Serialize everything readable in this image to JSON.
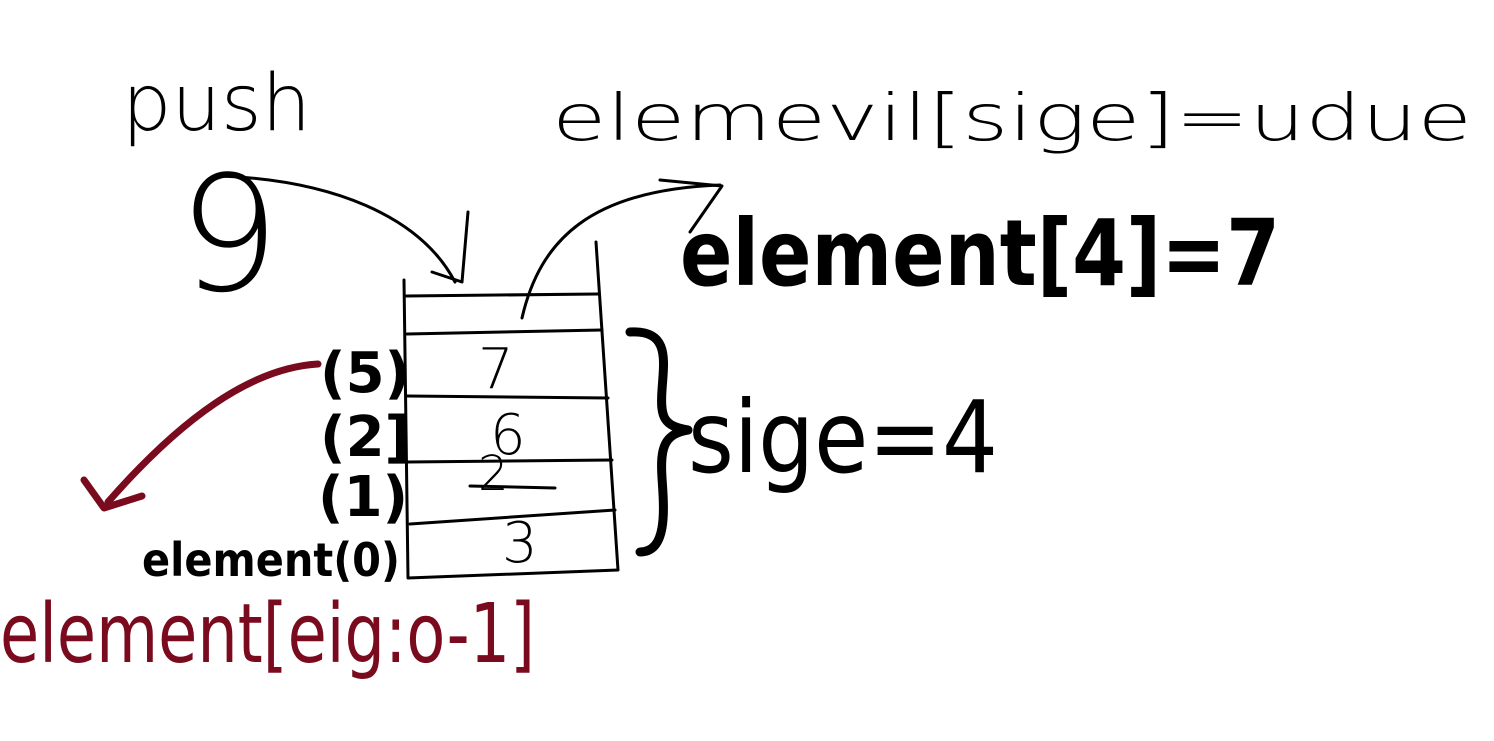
{
  "labels": {
    "push": "push",
    "pushed_value": "9",
    "assign_formula": "elemevil[sige]=udue",
    "assign_example": "element[4]=7",
    "size_label": "sige=4",
    "index_top": "(5)",
    "index_2": "(2]",
    "index_1": "(1)",
    "index_0": "element(0)",
    "last_index_formula": "element[eig:o-1]"
  },
  "stack": {
    "cells": [
      "7",
      "6",
      "2",
      "3"
    ]
  },
  "colors": {
    "ink": "#000000",
    "red_ink": "#7a0a1e",
    "background": "#ffffff"
  }
}
